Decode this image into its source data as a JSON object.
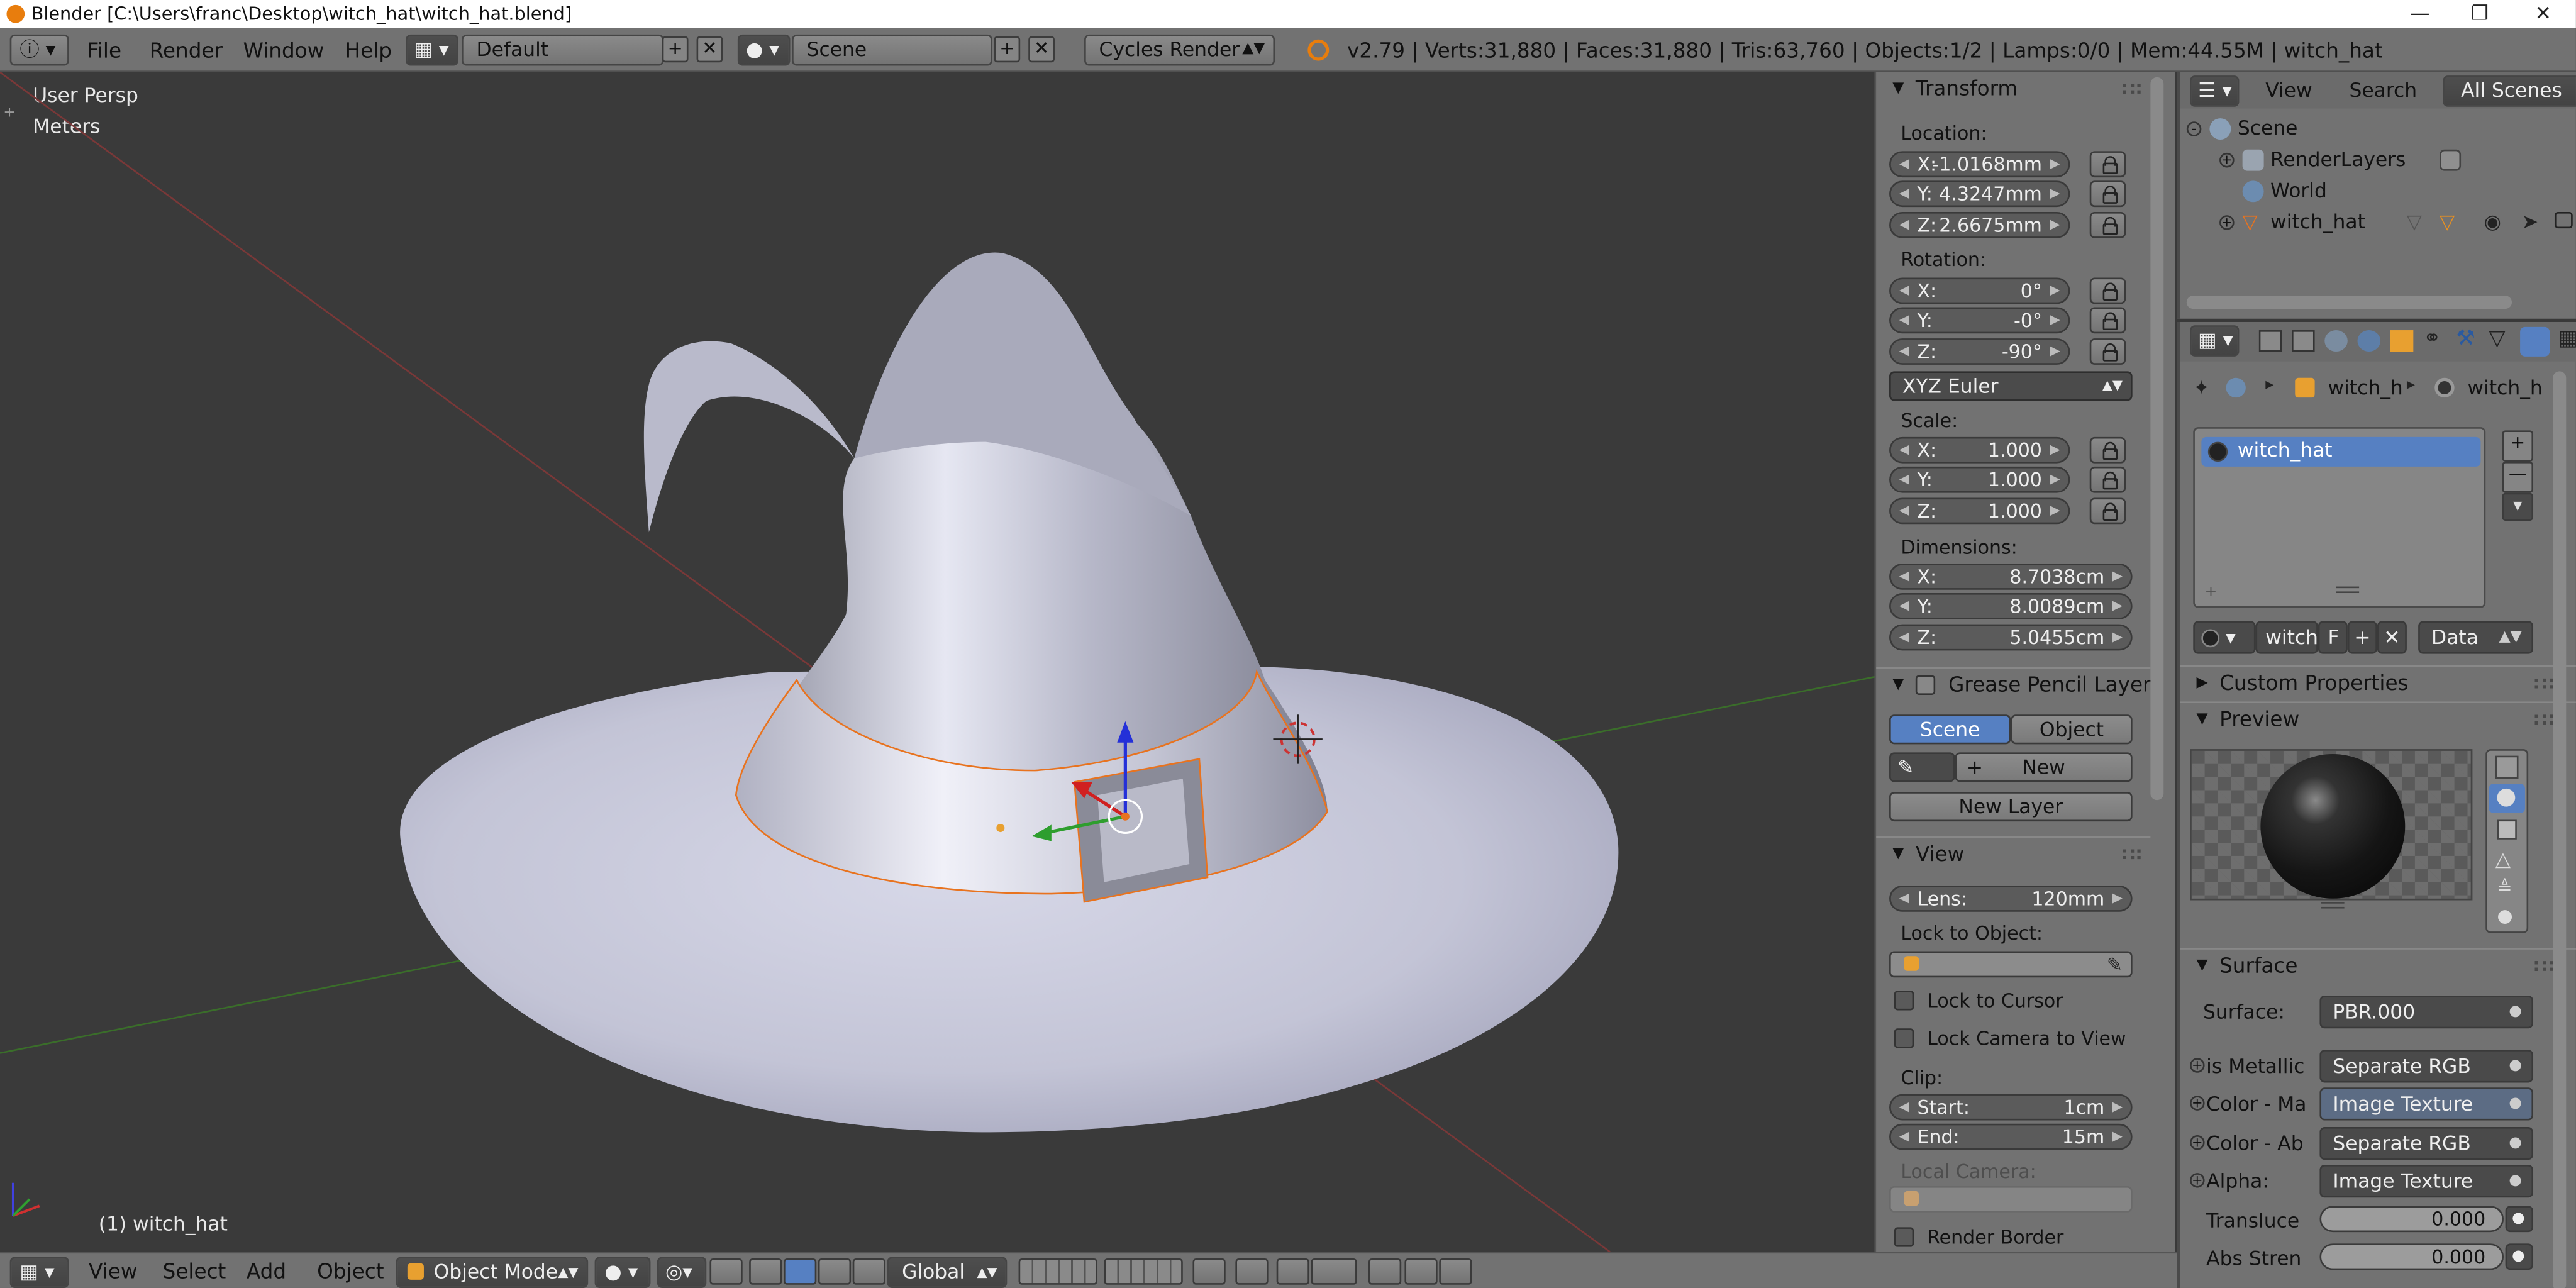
{
  "window": {
    "title": "Blender [C:\\Users\\franc\\Desktop\\witch_hat\\witch_hat.blend]"
  },
  "header": {
    "menus": [
      "File",
      "Render",
      "Window",
      "Help"
    ],
    "layout": "Default",
    "scene": "Scene",
    "engine": "Cycles Render",
    "stats": "v2.79 | Verts:31,880 | Faces:31,880 | Tris:63,760 | Objects:1/2 | Lamps:0/0 | Mem:44.55M | witch_hat"
  },
  "viewport": {
    "view_name": "User Persp",
    "units": "Meters",
    "object_label": "(1) witch_hat"
  },
  "npanel": {
    "transform": {
      "title": "Transform",
      "location_label": "Location:",
      "location": {
        "x": "-1.0168mm",
        "y": "4.3247mm",
        "z": "2.6675mm"
      },
      "rotation_label": "Rotation:",
      "rotation": {
        "x": "0°",
        "y": "-0°",
        "z": "-90°"
      },
      "rotation_mode": "XYZ Euler",
      "scale_label": "Scale:",
      "scale": {
        "x": "1.000",
        "y": "1.000",
        "z": "1.000"
      },
      "dimensions_label": "Dimensions:",
      "dimensions": {
        "x": "8.7038cm",
        "y": "8.0089cm",
        "z": "5.0455cm"
      },
      "axis_x": "X:",
      "axis_y": "Y:",
      "axis_z": "Z:"
    },
    "grease_pencil": {
      "title": "Grease Pencil Layer",
      "scene_tab": "Scene",
      "object_tab": "Object",
      "new_label": "New",
      "new_layer_label": "New Layer"
    },
    "view": {
      "title": "View",
      "lens_label": "Lens:",
      "lens_value": "120mm",
      "lock_to_object_label": "Lock to Object:",
      "lock_to_cursor": "Lock to Cursor",
      "lock_camera": "Lock Camera to View",
      "clip_label": "Clip:",
      "clip_start_label": "Start:",
      "clip_start": "1cm",
      "clip_end_label": "End:",
      "clip_end": "15m",
      "local_camera_label": "Local Camera:",
      "render_border": "Render Border"
    }
  },
  "outliner": {
    "menus": [
      "View",
      "Search"
    ],
    "filter": "All Scenes",
    "items": [
      {
        "label": "Scene"
      },
      {
        "label": "RenderLayers"
      },
      {
        "label": "World"
      },
      {
        "label": "witch_hat"
      }
    ]
  },
  "properties": {
    "breadcrumb": [
      "witch_h",
      "witch_h"
    ],
    "material_slot": "witch_hat",
    "datablock_name": "witch",
    "fake_user": "F",
    "link_mode": "Data",
    "custom_properties": "Custom Properties",
    "preview_title": "Preview",
    "surface_title": "Surface",
    "surface_rows": [
      {
        "label": "Surface:",
        "value": "PBR.000"
      },
      {
        "label": "is Metallic",
        "value": "Separate RGB"
      },
      {
        "label": "Color - Ma",
        "value": "Image Texture"
      },
      {
        "label": "Color - Ab",
        "value": "Separate RGB"
      },
      {
        "label": "Alpha:",
        "value": "Image Texture"
      }
    ],
    "translucency_label": "Transluce",
    "translucency_value": "0.000",
    "abs_strength_label": "Abs Stren",
    "abs_strength_value": "0.000"
  },
  "bottombar": {
    "menus": [
      "View",
      "Select",
      "Add",
      "Object"
    ],
    "mode": "Object Mode",
    "orientation": "Global"
  },
  "colors": {
    "panel": "#727272",
    "viewport_bg": "#3a3a3a",
    "selection_blue": "#5680c2",
    "selection_outline": "#e8731f",
    "hat": "#c9cad9"
  }
}
